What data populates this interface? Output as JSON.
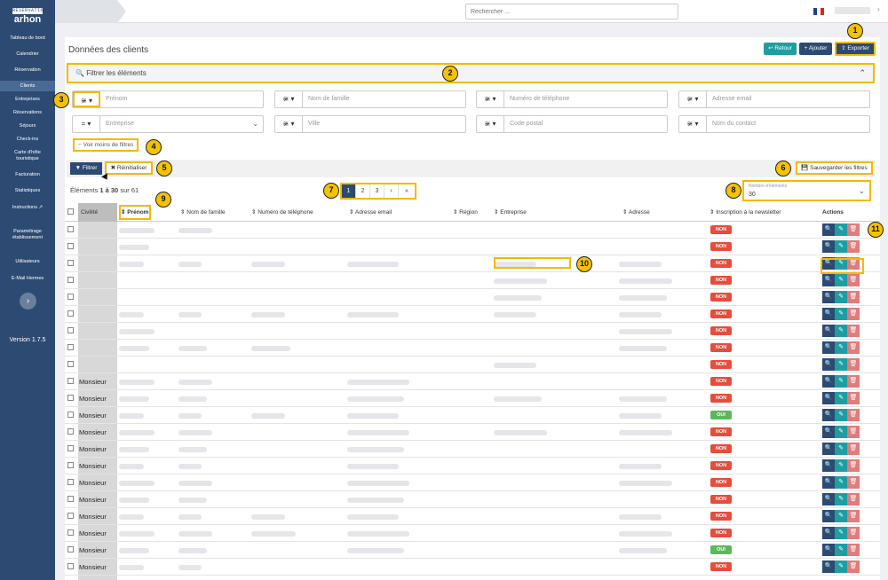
{
  "brand": {
    "tagline": "RÉSERVATION",
    "name": "arhon"
  },
  "sidebar": {
    "items": [
      {
        "label": "Tableau de bord"
      },
      {
        "label": "Calendrier"
      },
      {
        "label": "Réservation"
      },
      {
        "label": "Clients"
      },
      {
        "label": "Entreprises"
      },
      {
        "label": "Réservations"
      },
      {
        "label": "Séjours"
      },
      {
        "label": "Check-ins"
      },
      {
        "label": "Carte d'hôte touristique"
      },
      {
        "label": "Facturation"
      },
      {
        "label": "Statistiques"
      },
      {
        "label": "Instructions"
      },
      {
        "label": "Paramétrage établissement"
      },
      {
        "label": "Utilisateurs"
      },
      {
        "label": "E-Mail Hermes"
      }
    ],
    "collapse_glyph": "›",
    "version": "Version 1.7.5"
  },
  "topbar": {
    "search_placeholder": "Rechercher ...",
    "language_flag": "flag-fr-icon"
  },
  "page": {
    "title": "Données des clients",
    "buttons": {
      "back": "Retour",
      "add": "Ajouter",
      "export": "Exporter"
    }
  },
  "filters": {
    "bar_label": "Filtrer les éléments",
    "fields": [
      {
        "op": "≆ ▾",
        "placeholder": "Prénom"
      },
      {
        "op": "≆ ▾",
        "placeholder": "Nom de famille"
      },
      {
        "op": "≆ ▾",
        "placeholder": "Numéro de téléphone"
      },
      {
        "op": "≆ ▾",
        "placeholder": "Adresse email"
      },
      {
        "op": "= ▾",
        "placeholder": "Entreprise"
      },
      {
        "op": "≆ ▾",
        "placeholder": "Ville"
      },
      {
        "op": "≆ ▾",
        "placeholder": "Code postal"
      },
      {
        "op": "≆ ▾",
        "placeholder": "Nom du contact"
      }
    ],
    "less_filters": "− Voir moins de filtres",
    "filter_btn": "Filtrer",
    "reset_btn": "Réinitialiser",
    "save_btn": "Sauvegarder les filtres"
  },
  "listing": {
    "count_prefix": "Éléments",
    "count_range": "1 à 30",
    "count_suffix": "sur 61",
    "pages": [
      "1",
      "2",
      "3",
      "›",
      "»"
    ],
    "page_size_label": "Nombre d'éléments",
    "page_size_value": "30"
  },
  "table": {
    "columns": [
      {
        "label": "Civilité"
      },
      {
        "label": "⇕ Prénom"
      },
      {
        "label": "⇕ Nom de famille"
      },
      {
        "label": "⇕ Numéro de téléphone"
      },
      {
        "label": "⇕ Adresse email"
      },
      {
        "label": "⇕ Région"
      },
      {
        "label": "⇕ Entreprise"
      },
      {
        "label": "⇕ Adresse"
      },
      {
        "label": "⇕ Inscription à la newsletter"
      },
      {
        "label": "Actions"
      }
    ],
    "rows": [
      {
        "civ": "",
        "newsletter": "NON",
        "cols": [
          1,
          1,
          0,
          0,
          0,
          0,
          0
        ]
      },
      {
        "civ": "",
        "newsletter": "NON",
        "cols": [
          1,
          0,
          0,
          0,
          0,
          0,
          0
        ]
      },
      {
        "civ": "",
        "newsletter": "NON",
        "cols": [
          1,
          1,
          1,
          1,
          0,
          1,
          1
        ]
      },
      {
        "civ": "",
        "newsletter": "NON",
        "cols": [
          0,
          0,
          0,
          0,
          0,
          1,
          1
        ]
      },
      {
        "civ": "",
        "newsletter": "NON",
        "cols": [
          0,
          0,
          0,
          0,
          0,
          1,
          1
        ]
      },
      {
        "civ": "",
        "newsletter": "NON",
        "cols": [
          1,
          1,
          1,
          1,
          0,
          1,
          1
        ]
      },
      {
        "civ": "",
        "newsletter": "NON",
        "cols": [
          1,
          0,
          0,
          0,
          0,
          0,
          1
        ]
      },
      {
        "civ": "",
        "newsletter": "NON",
        "cols": [
          1,
          1,
          1,
          0,
          0,
          0,
          1
        ]
      },
      {
        "civ": "",
        "newsletter": "NON",
        "cols": [
          0,
          0,
          0,
          0,
          0,
          1,
          0
        ]
      },
      {
        "civ": "Monsieur",
        "newsletter": "NON",
        "cols": [
          1,
          1,
          0,
          1,
          0,
          0,
          0
        ]
      },
      {
        "civ": "Monsieur",
        "newsletter": "NON",
        "cols": [
          1,
          1,
          0,
          1,
          0,
          1,
          1
        ]
      },
      {
        "civ": "Monsieur",
        "newsletter": "OUI",
        "cols": [
          1,
          1,
          1,
          1,
          0,
          0,
          1
        ]
      },
      {
        "civ": "Monsieur",
        "newsletter": "NON",
        "cols": [
          1,
          1,
          0,
          1,
          0,
          1,
          1
        ]
      },
      {
        "civ": "Monsieur",
        "newsletter": "NON",
        "cols": [
          1,
          1,
          0,
          1,
          0,
          0,
          0
        ]
      },
      {
        "civ": "Monsieur",
        "newsletter": "NON",
        "cols": [
          1,
          1,
          0,
          1,
          0,
          0,
          1
        ]
      },
      {
        "civ": "Monsieur",
        "newsletter": "NON",
        "cols": [
          1,
          1,
          0,
          1,
          0,
          0,
          1
        ]
      },
      {
        "civ": "Monsieur",
        "newsletter": "NON",
        "cols": [
          1,
          1,
          0,
          1,
          0,
          0,
          0
        ]
      },
      {
        "civ": "Monsieur",
        "newsletter": "NON",
        "cols": [
          1,
          1,
          1,
          1,
          0,
          0,
          1
        ]
      },
      {
        "civ": "Monsieur",
        "newsletter": "NON",
        "cols": [
          1,
          1,
          1,
          1,
          0,
          0,
          1
        ]
      },
      {
        "civ": "Monsieur",
        "newsletter": "OUI",
        "cols": [
          1,
          1,
          0,
          1,
          0,
          0,
          1
        ]
      },
      {
        "civ": "Monsieur",
        "newsletter": "NON",
        "cols": [
          1,
          1,
          0,
          0,
          0,
          0,
          0
        ]
      }
    ],
    "actions": {
      "view": "🔍",
      "edit": "✎",
      "delete": "🗑"
    }
  },
  "colors": {
    "navy": "#2c4a72",
    "teal": "#1f9ea2",
    "red": "#e74c3c",
    "green": "#5cb85c",
    "highlight": "#f5b800"
  },
  "markers": [
    "1",
    "2",
    "3",
    "4",
    "5",
    "6",
    "7",
    "8",
    "9",
    "10",
    "11"
  ]
}
